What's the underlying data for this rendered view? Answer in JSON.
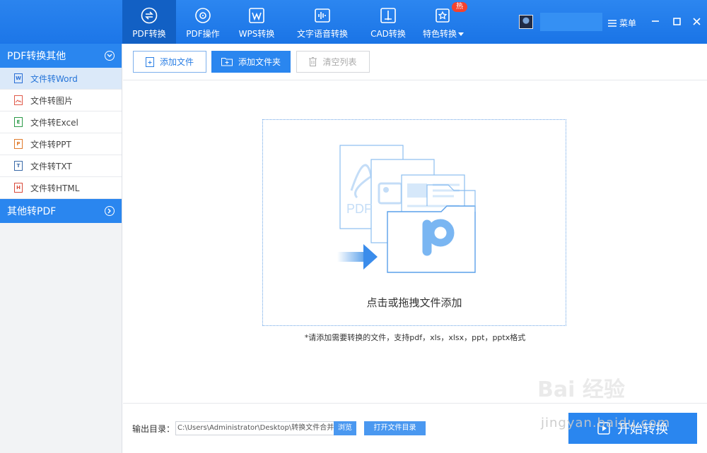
{
  "nav": {
    "items": [
      {
        "label": "PDF转换",
        "icon": "convert-icon"
      },
      {
        "label": "PDF操作",
        "icon": "settings-icon"
      },
      {
        "label": "WPS转换",
        "icon": "wps-icon"
      },
      {
        "label": "文字语音转换",
        "icon": "audio-wave-icon"
      },
      {
        "label": "CAD转换",
        "icon": "cad-icon"
      },
      {
        "label": "特色转换",
        "icon": "star-icon",
        "badge": "热"
      }
    ],
    "menu_label": "菜单"
  },
  "sidebar": {
    "group1": "PDF转换其他",
    "items": [
      {
        "label": "文件转Word",
        "letter": "W",
        "color": "#2a6fd6"
      },
      {
        "label": "文件转图片",
        "letter": "",
        "color": "#e05a4a"
      },
      {
        "label": "文件转Excel",
        "letter": "E",
        "color": "#2c9a48"
      },
      {
        "label": "文件转PPT",
        "letter": "P",
        "color": "#e07a2a"
      },
      {
        "label": "文件转TXT",
        "letter": "T",
        "color": "#3a6aa8"
      },
      {
        "label": "文件转HTML",
        "letter": "H",
        "color": "#d94a3a"
      }
    ],
    "group2": "其他转PDF"
  },
  "toolbar": {
    "add_file": "添加文件",
    "add_folder": "添加文件夹",
    "clear_list": "清空列表"
  },
  "drop": {
    "text": "点击或拖拽文件添加",
    "pdf_label": "PDF",
    "hint": "*请添加需要转换的文件，支持pdf，xls，xlsx，ppt，pptx格式"
  },
  "footer": {
    "output_label": "输出目录：",
    "output_path": "C:\\Users\\Administrator\\Desktop\\转换文件合并",
    "browse": "浏览",
    "open_folder": "打开文件目录",
    "start": "开始转换"
  },
  "watermark": {
    "text": "Bai 经验",
    "sub": "jingyan.baidu.com"
  },
  "colors": {
    "accent": "#2a86ef",
    "active_nav": "#1260c4"
  }
}
